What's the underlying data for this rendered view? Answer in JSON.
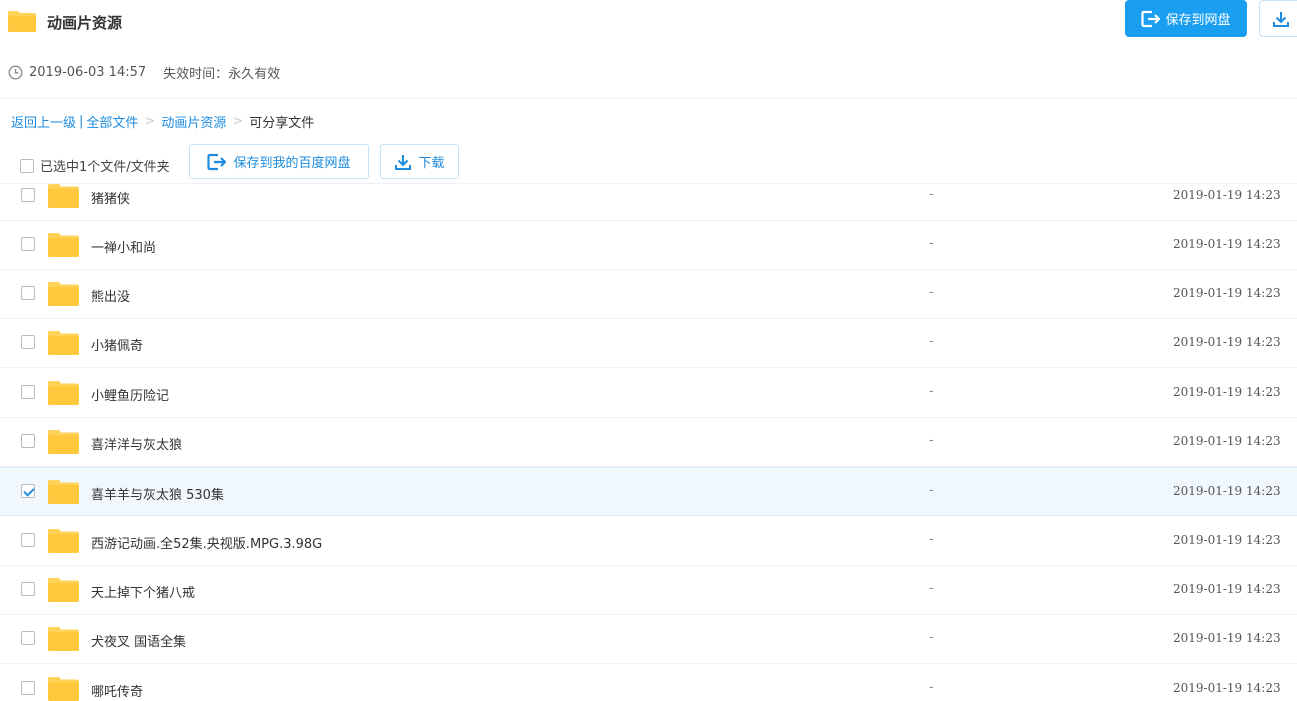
{
  "header": {
    "title": "动画片资源",
    "save_button_label": "保存到网盘"
  },
  "meta": {
    "share_time": "2019-06-03 14:57",
    "expire_label": "失效时间：",
    "expire_value": "永久有效"
  },
  "breadcrumb": {
    "back": "返回上一级",
    "bar": "|",
    "all_files": "全部文件",
    "sep": ">",
    "folder": "动画片资源",
    "current": "可分享文件"
  },
  "toolbar": {
    "selection_text": "已选中1个文件/文件夹",
    "save_label": "保存到我的百度网盘",
    "download_label": "下载"
  },
  "colors": {
    "accent": "#1a9ff0",
    "link": "#1d8ce0",
    "folder": "#ffd25a",
    "selected_row": "#f0f8fe"
  },
  "files": [
    {
      "name": "猪猪侠",
      "size": "-",
      "date": "2019-01-19 14:23",
      "checked": false
    },
    {
      "name": "一禅小和尚",
      "size": "-",
      "date": "2019-01-19 14:23",
      "checked": false
    },
    {
      "name": "熊出没",
      "size": "-",
      "date": "2019-01-19 14:23",
      "checked": false
    },
    {
      "name": "小猪佩奇",
      "size": "-",
      "date": "2019-01-19 14:23",
      "checked": false
    },
    {
      "name": "小鲤鱼历险记",
      "size": "-",
      "date": "2019-01-19 14:23",
      "checked": false
    },
    {
      "name": "喜洋洋与灰太狼",
      "size": "-",
      "date": "2019-01-19 14:23",
      "checked": false
    },
    {
      "name": "喜羊羊与灰太狼 530集",
      "size": "-",
      "date": "2019-01-19 14:23",
      "checked": true
    },
    {
      "name": "西游记动画.全52集.央视版.MPG.3.98G",
      "size": "-",
      "date": "2019-01-19 14:23",
      "checked": false
    },
    {
      "name": "天上掉下个猪八戒",
      "size": "-",
      "date": "2019-01-19 14:23",
      "checked": false
    },
    {
      "name": "犬夜叉 国语全集",
      "size": "-",
      "date": "2019-01-19 14:23",
      "checked": false
    },
    {
      "name": "哪吒传奇",
      "size": "-",
      "date": "2019-01-19 14:23",
      "checked": false
    }
  ]
}
